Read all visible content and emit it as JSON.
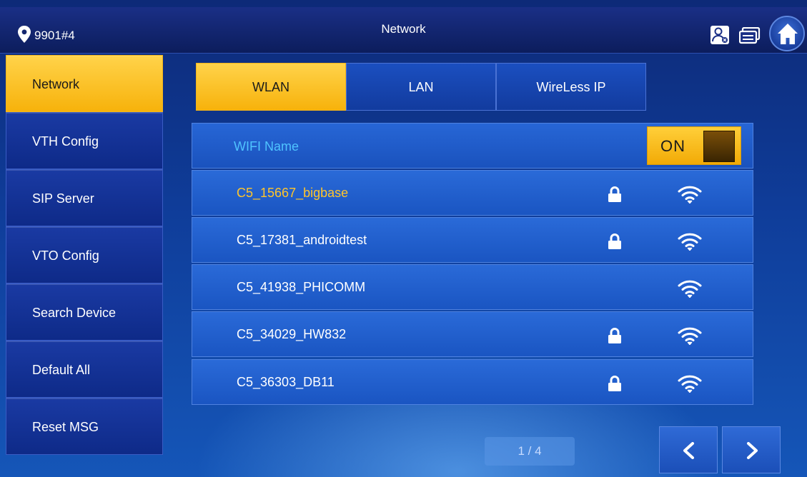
{
  "header": {
    "location": "9901#4",
    "title": "Network",
    "icons": [
      "location-icon",
      "contact-icon",
      "message-icon",
      "home-icon"
    ]
  },
  "sidebar": {
    "items": [
      {
        "label": "Network",
        "active": true
      },
      {
        "label": "VTH Config",
        "active": false
      },
      {
        "label": "SIP Server",
        "active": false
      },
      {
        "label": "VTO Config",
        "active": false
      },
      {
        "label": "Search Device",
        "active": false
      },
      {
        "label": "Default All",
        "active": false
      },
      {
        "label": "Reset MSG",
        "active": false
      }
    ]
  },
  "tabs": [
    {
      "label": "WLAN",
      "active": true
    },
    {
      "label": "LAN",
      "active": false
    },
    {
      "label": "WireLess IP",
      "active": false
    }
  ],
  "wifi": {
    "header_label": "WIFI Name",
    "toggle_label": "ON",
    "enabled": true,
    "networks": [
      {
        "name": "C5_15667_bigbase",
        "secured": true,
        "selected": true
      },
      {
        "name": "C5_17381_androidtest",
        "secured": true,
        "selected": false
      },
      {
        "name": "C5_41938_PHICOMM",
        "secured": false,
        "selected": false
      },
      {
        "name": "C5_34029_HW832",
        "secured": true,
        "selected": false
      },
      {
        "name": "C5_36303_DB11",
        "secured": true,
        "selected": false
      }
    ]
  },
  "pager": {
    "text": "1 / 4"
  },
  "colors": {
    "accent": "#f7b20b",
    "selected_text": "#ffc52b",
    "header_label": "#4fc3ff",
    "panel": "#1a55c2"
  }
}
